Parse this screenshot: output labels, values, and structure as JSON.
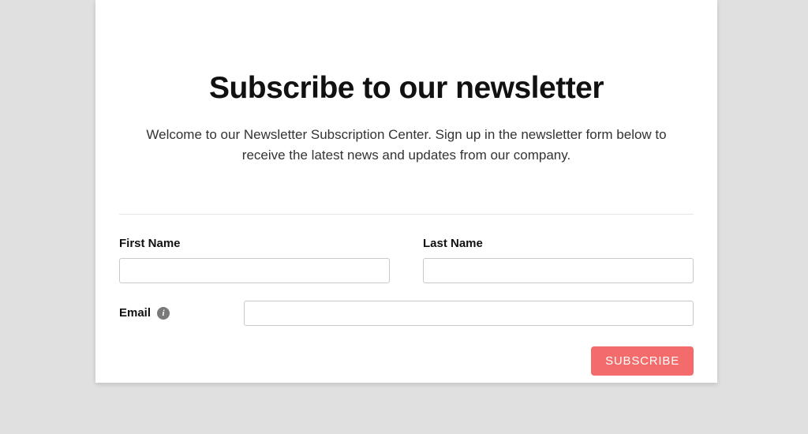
{
  "header": {
    "title": "Subscribe to our newsletter",
    "description": "Welcome to our Newsletter Subscription Center. Sign up in the newsletter form below to receive the latest news and updates from our company."
  },
  "form": {
    "first_name": {
      "label": "First Name",
      "value": ""
    },
    "last_name": {
      "label": "Last Name",
      "value": ""
    },
    "email": {
      "label": "Email",
      "value": "",
      "info_glyph": "i"
    },
    "submit_label": "SUBSCRIBE"
  }
}
